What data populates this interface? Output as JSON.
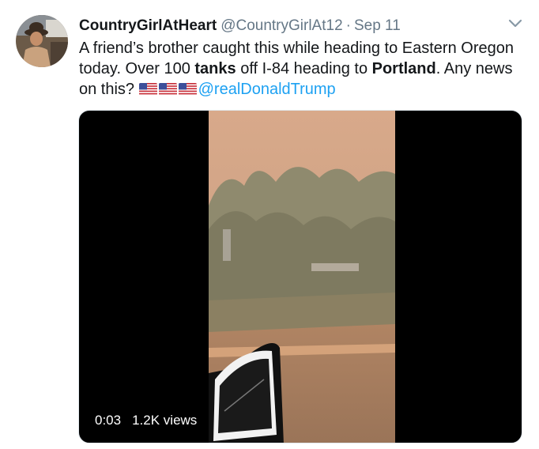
{
  "tweet": {
    "display_name": "CountryGirlAtHeart",
    "handle": "@CountryGirlAt12",
    "separator": "·",
    "date": "Sep 11",
    "text_part1": "A friend’s brother caught this while heading to Eastern Oregon today. Over 100 ",
    "text_bold1": "tanks",
    "text_part2": " off I-84 heading to ",
    "text_bold2": "Portland",
    "text_part3": ". Any news on this? ",
    "flags": [
      "us-flag-icon",
      "us-flag-icon",
      "us-flag-icon"
    ],
    "mention": "@realDonaldTrump"
  },
  "video": {
    "time": "0:03",
    "views": "1.2K views"
  },
  "colors": {
    "link": "#1da1f2",
    "secondary_text": "#657786",
    "primary_text": "#14171a"
  }
}
